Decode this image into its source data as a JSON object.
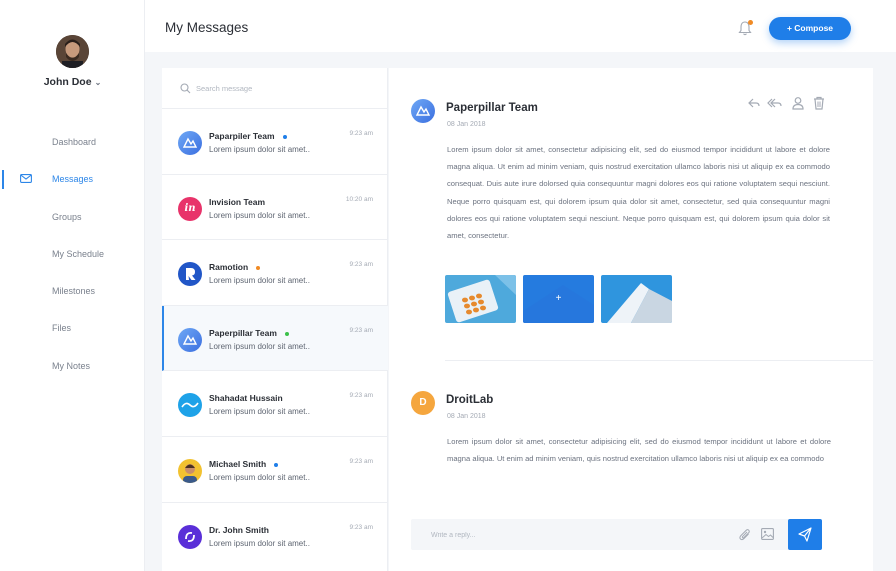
{
  "user": {
    "name": "John Doe"
  },
  "sidebar": {
    "items": [
      {
        "label": "Dashboard"
      },
      {
        "label": "Messages"
      },
      {
        "label": "Groups"
      },
      {
        "label": "My Schedule"
      },
      {
        "label": "Milestones"
      },
      {
        "label": "Files"
      },
      {
        "label": "My Notes"
      }
    ]
  },
  "header": {
    "title": "My Messages",
    "compose_label": "+ Compose"
  },
  "search": {
    "placeholder": "Search message"
  },
  "messages": [
    {
      "sender": "Paparpiler Team",
      "preview": "Lorem ipsum dolor sit amet..",
      "time": "9:23 am",
      "dot_color": "#1f7ee8",
      "avatar": "paperpillar-logo"
    },
    {
      "sender": "Invision Team",
      "preview": "Lorem ipsum dolor sit amet..",
      "time": "10:20 am",
      "avatar": "invision-logo",
      "avatar_text": "in"
    },
    {
      "sender": "Ramotion",
      "preview": "Lorem ipsum dolor sit amet..",
      "time": "9:23 am",
      "dot_color": "#f08a24",
      "avatar": "ramotion-logo"
    },
    {
      "sender": "Paperpillar Team",
      "preview": "Lorem ipsum dolor sit amet..",
      "time": "9:23 am",
      "dot_color": "#3cc14a",
      "avatar": "paperpillar-logo"
    },
    {
      "sender": "Shahadat Hussain",
      "preview": "Lorem ipsum dolor sit amet..",
      "time": "9:23 am",
      "avatar": "shahadat-logo"
    },
    {
      "sender": "Michael Smith",
      "preview": "Lorem ipsum dolor sit amet..",
      "time": "9:23 am",
      "dot_color": "#1f7ee8",
      "avatar": "person-photo"
    },
    {
      "sender": "Dr. John Smith",
      "preview": "Lorem ipsum dolor sit amet..",
      "time": "9:23 am",
      "avatar": "dr-smith-logo"
    }
  ],
  "thread": [
    {
      "sender": "Paperpillar Team",
      "date": "08 Jan 2018",
      "body": "Lorem ipsum dolor sit amet, consectetur adipisicing elit, sed do eiusmod tempor incididunt ut labore et dolore magna aliqua. Ut enim ad minim veniam, quis nostrud exercitation ullamco laboris nisi ut aliquip ex ea commodo consequat. Duis aute irure dolorsed quia consequuntur magni dolores eos qui ratione voluptatem sequi nesciunt. Neque porro quisquam est, qui dolorem ipsum quia dolor sit amet, consectetur, sed quia consequuntur magni dolores eos qui ratione voluptatem sequi nesciunt. Neque porro quisquam est, qui dolorem ipsum quia dolor sit amet, consectetur."
    },
    {
      "sender": "DroitLab",
      "avatar_letter": "D",
      "date": "08 Jan 2018",
      "body": "Lorem ipsum dolor sit amet, consectetur adipisicing elit, sed do eiusmod tempor incididunt ut labore et dolore magna aliqua. Ut enim ad minim veniam, quis nostrud exercitation ullamco laboris nisi ut aliquip ex ea commodo"
    }
  ],
  "attachments": [
    {
      "name": "pills-image"
    },
    {
      "name": "blue-image",
      "overlay": "+"
    },
    {
      "name": "building-image"
    }
  ],
  "reply": {
    "placeholder": "Write a reply..."
  },
  "colors": {
    "accent": "#1f7ee8",
    "active_nav": "#2c86e8",
    "notification": "#f08a24"
  }
}
